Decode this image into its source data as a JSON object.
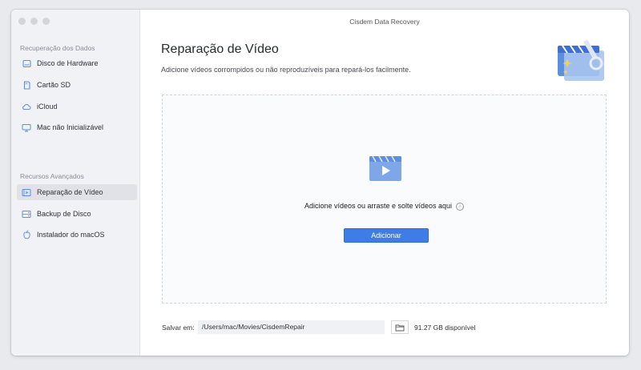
{
  "window": {
    "title": "Cisdem Data Recovery"
  },
  "sidebar": {
    "section1": "Recuperação dos Dados",
    "items1": [
      {
        "label": "Disco de Hardware",
        "icon": "hard-drive-icon"
      },
      {
        "label": "Cartão SD",
        "icon": "sd-card-icon"
      },
      {
        "label": "iCloud",
        "icon": "cloud-icon"
      },
      {
        "label": "Mac não Inicializável",
        "icon": "monitor-icon"
      }
    ],
    "section2": "Recursos Avançados",
    "items2": [
      {
        "label": "Reparação de Vídeo",
        "icon": "video-repair-icon",
        "active": true
      },
      {
        "label": "Backup de Disco",
        "icon": "disk-backup-icon"
      },
      {
        "label": "Instalador do macOS",
        "icon": "apple-icon"
      }
    ]
  },
  "main": {
    "title": "Reparação de Vídeo",
    "subtitle": "Adicione vídeos corrompidos ou não reproduzíveis para repará-los facilmente.",
    "dropzone": {
      "text": "Adicione vídeos ou arraste e solte vídeos aqui",
      "button": "Adicionar"
    },
    "bottom": {
      "save_label": "Salvar em:",
      "path": "/Users/mac/Movies/CisdemRepair",
      "space": "91.27 GB disponível"
    }
  },
  "colors": {
    "accent": "#3f7de6",
    "sidebar_bg": "#f1f2f6",
    "icon_blue": "#5b8fe0"
  }
}
